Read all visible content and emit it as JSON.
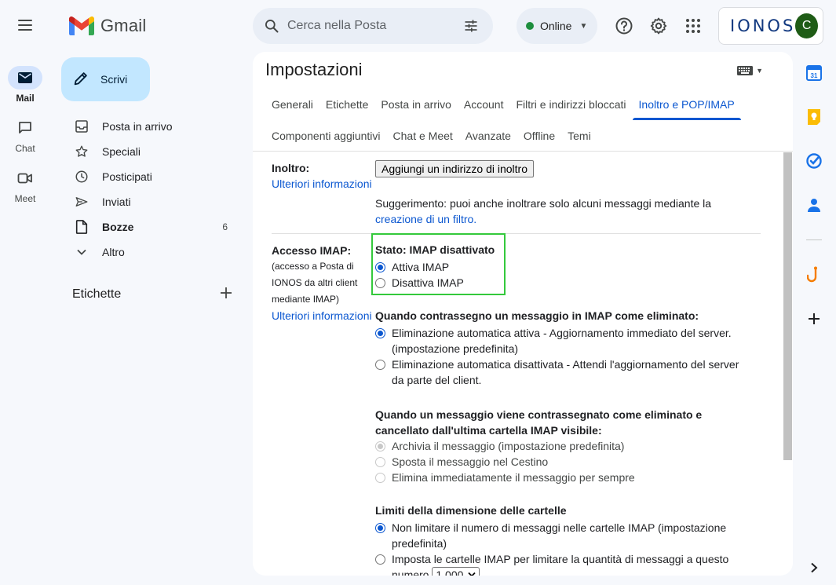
{
  "header": {
    "logo_text": "Gmail",
    "search_placeholder": "Cerca nella Posta",
    "status_label": "Online",
    "brand_text": "IONOS",
    "avatar_initial": "C"
  },
  "rail": [
    {
      "label": "Mail",
      "icon": "mail-icon",
      "active": true
    },
    {
      "label": "Chat",
      "icon": "chat-icon",
      "active": false
    },
    {
      "label": "Meet",
      "icon": "meet-icon",
      "active": false
    }
  ],
  "compose_label": "Scrivi",
  "nav": {
    "items": [
      {
        "label": "Posta in arrivo",
        "icon": "inbox-icon"
      },
      {
        "label": "Speciali",
        "icon": "star-icon"
      },
      {
        "label": "Posticipati",
        "icon": "clock-icon"
      },
      {
        "label": "Inviati",
        "icon": "send-icon"
      },
      {
        "label": "Bozze",
        "icon": "draft-icon",
        "count": "6",
        "bold": true
      },
      {
        "label": "Altro",
        "icon": "chevron-down-icon"
      }
    ],
    "labels_header": "Etichette"
  },
  "settings": {
    "title": "Impostazioni",
    "tabs_row1": [
      "Generali",
      "Etichette",
      "Posta in arrivo",
      "Account",
      "Filtri e indirizzi bloccati",
      "Inoltro e POP/IMAP"
    ],
    "tabs_row2": [
      "Componenti aggiuntivi",
      "Chat e Meet",
      "Avanzate",
      "Offline",
      "Temi"
    ],
    "active_tab": "Inoltro e POP/IMAP",
    "forwarding": {
      "label": "Inoltro:",
      "more_info": "Ulteriori informazioni",
      "add_button": "Aggiungi un indirizzo di inoltro",
      "tip": "Suggerimento: puoi anche inoltrare solo alcuni messaggi mediante la",
      "tip_link": "creazione di un filtro."
    },
    "imap": {
      "label": "Accesso IMAP:",
      "sub1": "(accesso a Posta di",
      "sub2": "IONOS da altri client",
      "sub3": "mediante IMAP)",
      "more_info": "Ulteriori informazioni",
      "status": "Stato: IMAP disattivato",
      "enable": "Attiva IMAP",
      "disable": "Disattiva IMAP",
      "deleted_heading": "Quando contrassegno un messaggio in IMAP come eliminato:",
      "auto_on_1": "Eliminazione automatica attiva - Aggiornamento immediato del server.",
      "auto_on_2": "(impostazione predefinita)",
      "auto_off_1": "Eliminazione automatica disattivata - Attendi l'aggiornamento del server",
      "auto_off_2": "da parte del client.",
      "expunge_heading_1": "Quando un messaggio viene contrassegnato come eliminato e",
      "expunge_heading_2": "cancellato dall'ultima cartella IMAP visibile:",
      "archive": "Archivia il messaggio (impostazione predefinita)",
      "trash": "Sposta il messaggio nel Cestino",
      "delete_forever": "Elimina immediatamente il messaggio per sempre",
      "limits_heading": "Limiti della dimensione delle cartelle",
      "no_limit_1": "Non limitare il numero di messaggi nelle cartelle IMAP (impostazione",
      "no_limit_2": "predefinita)",
      "limit_1": "Imposta le cartelle IMAP per limitare la quantità di messaggi a questo",
      "limit_2": "numero",
      "limit_value": "1.000"
    }
  }
}
